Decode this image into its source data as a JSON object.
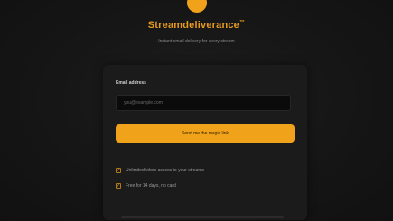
{
  "brand": {
    "name": "Streamdeliverance",
    "trademark": "™",
    "tagline": "Instant email delivery for every stream",
    "accent_color": "#f0a21a"
  },
  "form": {
    "label": "Email address",
    "input_placeholder": "you@example.com",
    "submit_label": "Send me the magic link"
  },
  "features": [
    {
      "icon": "check-icon",
      "text": "Unlimited inbox access to your streams"
    },
    {
      "icon": "check-icon",
      "text": "Free for 14 days, no card"
    }
  ]
}
